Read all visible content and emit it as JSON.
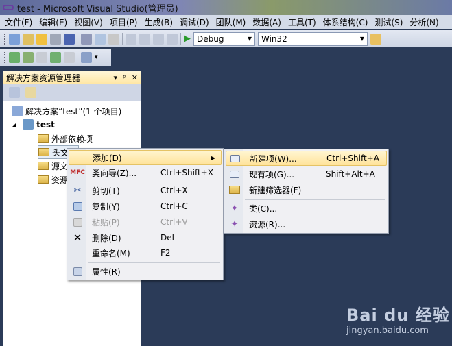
{
  "window": {
    "title": "test - Microsoft Visual Studio(管理员)"
  },
  "menubar": [
    "文件(F)",
    "编辑(E)",
    "视图(V)",
    "项目(P)",
    "生成(B)",
    "调试(D)",
    "团队(M)",
    "数据(A)",
    "工具(T)",
    "体系结构(C)",
    "测试(S)",
    "分析(N)"
  ],
  "toolbar": {
    "config": "Debug",
    "platform": "Win32"
  },
  "solution_explorer": {
    "title": "解决方案资源管理器",
    "solution": "解决方案“test”(1 个项目)",
    "project": "test",
    "items": [
      "外部依赖项",
      "头文件",
      "源文件",
      "资源文件"
    ]
  },
  "context_menu": [
    {
      "label": "添加(D)",
      "shortcut": ""
    },
    {
      "label": "类向导(Z)...",
      "shortcut": "Ctrl+Shift+X"
    },
    {
      "label": "剪切(T)",
      "shortcut": "Ctrl+X"
    },
    {
      "label": "复制(Y)",
      "shortcut": "Ctrl+C"
    },
    {
      "label": "粘贴(P)",
      "shortcut": "Ctrl+V"
    },
    {
      "label": "删除(D)",
      "shortcut": "Del"
    },
    {
      "label": "重命名(M)",
      "shortcut": "F2"
    },
    {
      "label": "属性(R)",
      "shortcut": ""
    }
  ],
  "submenu": [
    {
      "label": "新建项(W)...",
      "shortcut": "Ctrl+Shift+A"
    },
    {
      "label": "现有项(G)...",
      "shortcut": "Shift+Alt+A"
    },
    {
      "label": "新建筛选器(F)",
      "shortcut": ""
    },
    {
      "label": "类(C)...",
      "shortcut": ""
    },
    {
      "label": "资源(R)...",
      "shortcut": ""
    }
  ],
  "watermark": {
    "brand": "Bai du 经验",
    "url": "jingyan.baidu.com"
  }
}
